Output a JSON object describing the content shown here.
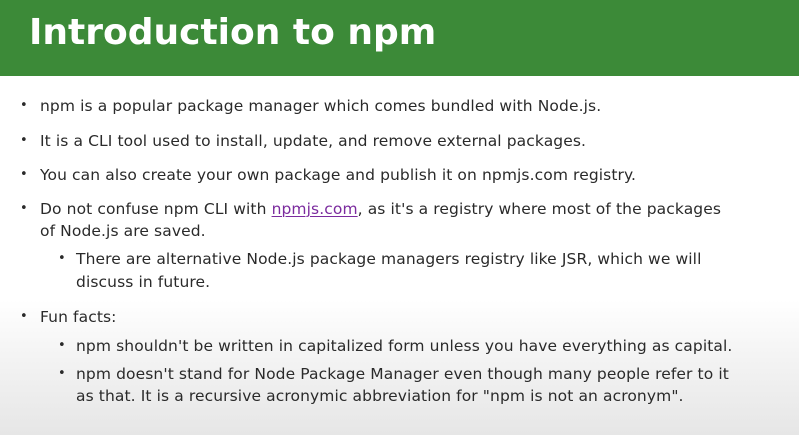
{
  "slide": {
    "title": "Introduction to npm",
    "bullets": [
      {
        "text": "npm is a popular package manager which comes bundled with Node.js."
      },
      {
        "text": "It is a CLI tool used to install, update, and remove external packages."
      },
      {
        "text": "You can also create your own package and publish it on npmjs.com registry."
      },
      {
        "text_before_link": "Do not confuse npm CLI with ",
        "link_text": "npmjs.com",
        "text_after_link": ", as it's a registry where most of the packages",
        "text_line2": "of Node.js are saved.",
        "sub": [
          {
            "text_line1": "There are alternative Node.js package managers registry like JSR, which we will",
            "text_line2": "discuss in future."
          }
        ]
      },
      {
        "text": "Fun facts:",
        "sub": [
          {
            "text_line1": "npm shouldn't be written in capitalized form unless you have everything as capital."
          },
          {
            "text_line1": "npm doesn't stand for Node Package Manager even though many people refer to it",
            "text_line2": "as that. It is a recursive acronymic abbreviation for \"npm is not an acronym\"."
          }
        ]
      }
    ],
    "bullet_glyph": "•"
  },
  "colors": {
    "header_bg": "#3c8a38",
    "title_text": "#ffffff",
    "body_text": "#2a2a2a",
    "link": "#7b2b9e"
  }
}
